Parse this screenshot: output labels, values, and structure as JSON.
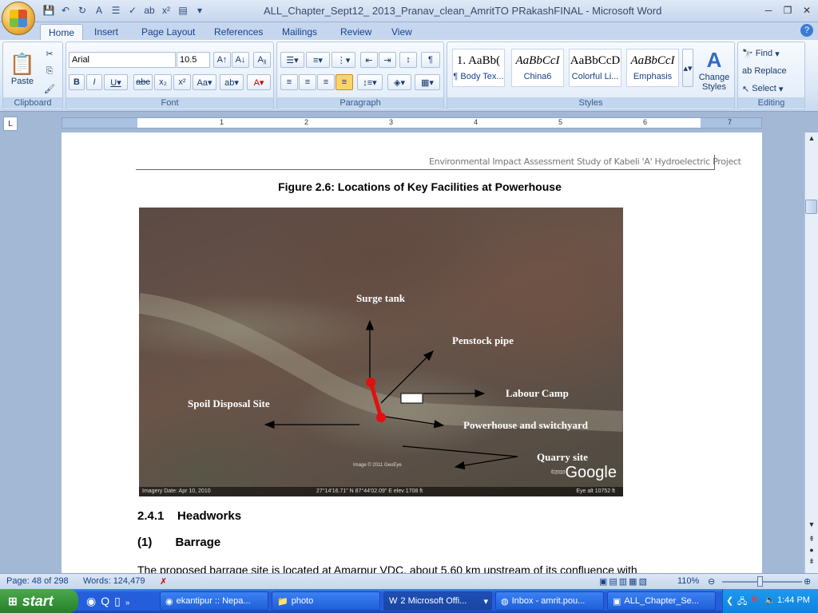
{
  "window": {
    "title": "ALL_Chapter_Sept12_ 2013_Pranav_clean_AmritTO PRakashFINAL - Microsoft Word"
  },
  "tabs": [
    "Home",
    "Insert",
    "Page Layout",
    "References",
    "Mailings",
    "Review",
    "View"
  ],
  "ribbon": {
    "clipboard": {
      "label": "Clipboard",
      "paste": "Paste"
    },
    "font": {
      "label": "Font",
      "family": "Arial",
      "size": "10.5"
    },
    "paragraph": {
      "label": "Paragraph"
    },
    "styles": {
      "label": "Styles",
      "items": [
        {
          "sample": "1. AaBb(",
          "name": "¶ Body Tex..."
        },
        {
          "sample": "AaBbCcI",
          "name": "China6"
        },
        {
          "sample": "AaBbCcD",
          "name": "Colorful Li..."
        },
        {
          "sample": "AaBbCcI",
          "name": "Emphasis"
        }
      ],
      "change_styles": "Change Styles"
    },
    "editing": {
      "label": "Editing",
      "find": "Find",
      "replace": "Replace",
      "select": "Select"
    }
  },
  "ruler": {
    "numbers": [
      "1",
      "2",
      "3",
      "4",
      "5",
      "6",
      "7"
    ]
  },
  "document": {
    "header": "Environmental Impact Assessment Study of Kabeli 'A' Hydroelectric Project",
    "figure_caption": "Figure 2.6: Locations of Key Facilities at Powerhouse",
    "map_labels": {
      "surge_tank": "Surge tank",
      "penstock": "Penstock pipe",
      "labour_camp": "Labour Camp",
      "spoil": "Spoil Disposal Site",
      "powerhouse": "Powerhouse and switchyard",
      "quarry": "Quarry site"
    },
    "map_footer_left": "Imagery Date: Apr 10, 2010",
    "map_footer_mid": "27°14'16.71\" N    87°44'02.09\" E    elev  1708 ft",
    "map_footer_right": "Eye alt   10752 ft",
    "map_copyright": "Image © 2011 GeoEye",
    "google_logo": "Google",
    "google_small": "©2010",
    "heading1": "2.4.1    Headworks",
    "heading2": "(1)       Barrage",
    "body": "The proposed barrage site is located at Amarpur VDC, about 5.60 km upstream of its confluence with"
  },
  "status": {
    "page": "Page: 48 of 298",
    "words": "Words: 124,479",
    "zoom": "110%"
  },
  "taskbar": {
    "start": "start",
    "items": [
      "ekantipur :: Nepa...",
      "photo",
      "2 Microsoft Offi...",
      "Inbox - amrit.pou...",
      "ALL_Chapter_Se..."
    ],
    "time": "1:44 PM"
  }
}
